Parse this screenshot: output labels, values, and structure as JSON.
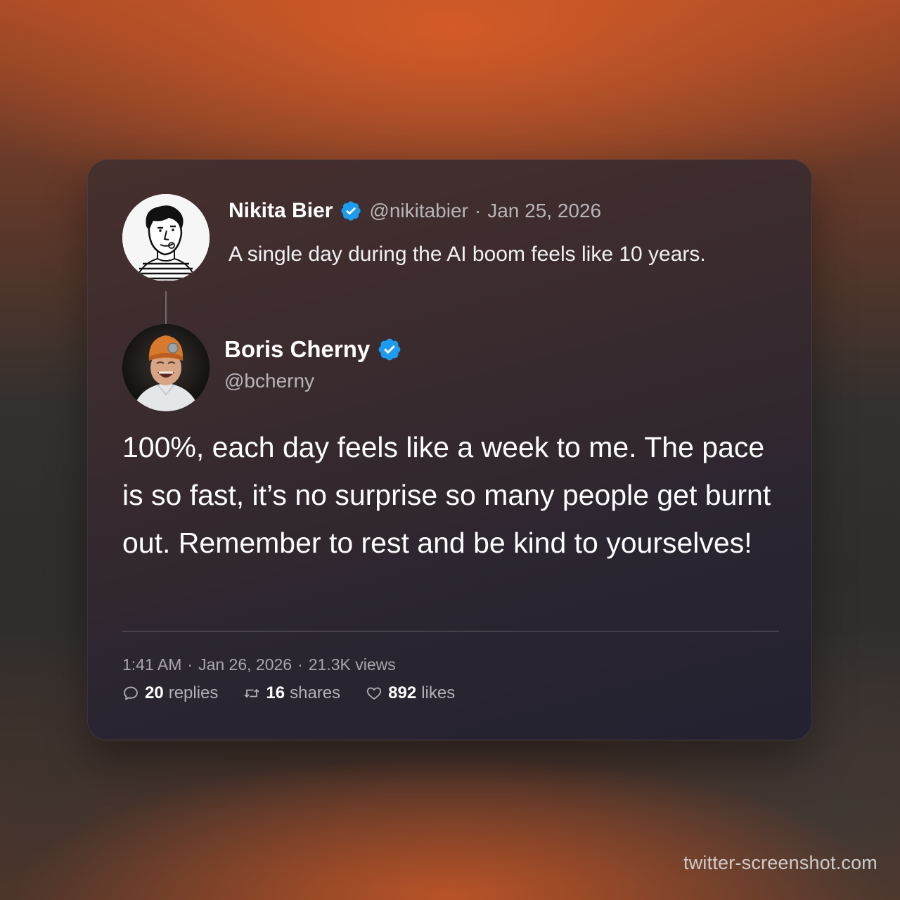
{
  "parent_tweet": {
    "name": "Nikita Bier",
    "handle": "@nikitabier",
    "separator": "·",
    "date": "Jan 25, 2026",
    "text": "A single day during the AI boom feels like 10 years.",
    "avatar_icon": "sketch-portrait-avatar",
    "verified_icon": "verified-badge-icon"
  },
  "tweet": {
    "name": "Boris Cherny",
    "handle": "@bcherny",
    "text": "100%, each day feels like a week to me. The pace is so fast, it’s no surprise so many people get burnt out. Remember to rest and be kind to yourselves!",
    "avatar_icon": "photo-avatar-orange-beanie",
    "verified_icon": "verified-badge-icon",
    "meta": {
      "time": "1:41 AM",
      "date": "Jan 26, 2026",
      "views": "21.3K views",
      "separator": "·"
    },
    "stats": {
      "replies_count": "20",
      "replies_label": "replies",
      "shares_count": "16",
      "shares_label": "shares",
      "likes_count": "892",
      "likes_label": "likes"
    }
  },
  "watermark": "twitter-screenshot.com",
  "colors": {
    "verified_blue": "#1d9bf0",
    "card_top": "#47302e",
    "card_bottom": "#232231",
    "background_orange": "#c45a2c"
  }
}
